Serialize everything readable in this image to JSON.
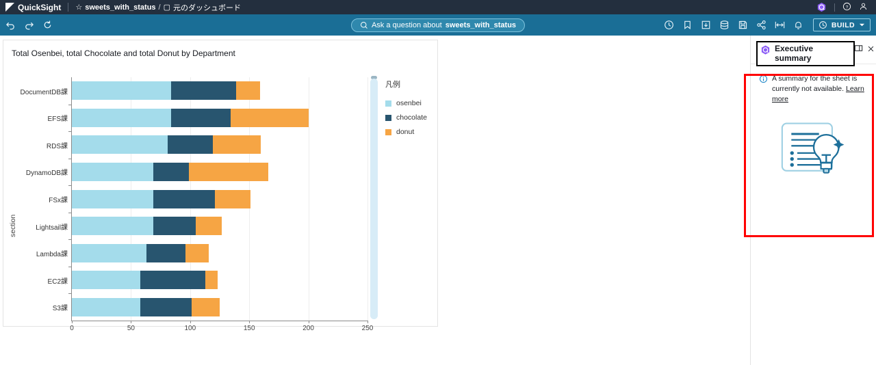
{
  "topbar": {
    "product": "QuickSight",
    "breadcrumb": {
      "dataset": "sweets_with_status",
      "separator": "/",
      "sheet": "元のダッシュボード"
    },
    "icons": {
      "star": "star-icon",
      "sheet": "sheet-icon",
      "q": "q-assistant-icon",
      "help": "help-icon",
      "user": "user-icon"
    }
  },
  "toolbar": {
    "undo": "undo-icon",
    "redo": "redo-icon",
    "reset": "reset-icon",
    "ask_prefix": "Ask a question about ",
    "ask_dataset": "sweets_with_status",
    "right_icons": [
      "clock-icon",
      "bookmark-icon",
      "download-icon",
      "data-icon",
      "save-icon",
      "share-icon",
      "fit-width-icon",
      "bell-icon"
    ],
    "build_label": "BUILD"
  },
  "visual": {
    "title": "Total Osenbei, total Chocolate and total Donut by Department",
    "legend_title": "凡例"
  },
  "right_panel": {
    "title": "Executive summary",
    "note_text": "A summary for the sheet is currently not available. ",
    "note_link": "Learn more",
    "layout_icon": "panel-layout-icon",
    "close_icon": "close-icon",
    "illustration": "summary-lightbulb-illustration"
  },
  "colors": {
    "osenbei": "#a4dceb",
    "chocolate": "#28556f",
    "donut": "#f6a544",
    "topbar": "#232f3e",
    "toolbar": "#1a6e96",
    "highlight": "#ff0000"
  },
  "chart_data": {
    "type": "bar",
    "orientation": "horizontal",
    "stacked": true,
    "title": "Total Osenbei, total Chocolate and total Donut by Department",
    "xlabel": "",
    "ylabel": "section",
    "xlim": [
      0,
      250
    ],
    "xticks": [
      0,
      50,
      100,
      150,
      200,
      250
    ],
    "grid": true,
    "legend_position": "right",
    "categories": [
      "DocumentDB課",
      "EFS課",
      "RDS課",
      "DynamoDB課",
      "FSx課",
      "Lightsail課",
      "Lambda課",
      "EC2課",
      "S3課"
    ],
    "series": [
      {
        "name": "osenbei",
        "color": "#a4dceb",
        "values": [
          84,
          84,
          81,
          69,
          69,
          69,
          63,
          58,
          58
        ]
      },
      {
        "name": "chocolate",
        "color": "#28556f",
        "values": [
          55,
          50,
          38,
          30,
          52,
          36,
          33,
          55,
          43
        ]
      },
      {
        "name": "donut",
        "color": "#f6a544",
        "values": [
          20,
          66,
          41,
          67,
          30,
          22,
          20,
          10,
          24
        ]
      }
    ]
  }
}
